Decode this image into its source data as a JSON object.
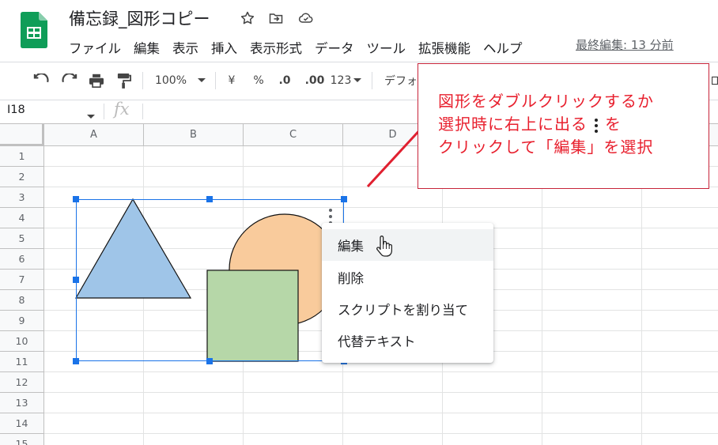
{
  "app": {
    "doc_title": "備忘録_図形コピー",
    "last_edit": "最終編集: 13 分前",
    "accent": "#1a73e8",
    "logo_color": "#0f9d58"
  },
  "menu": [
    "ファイル",
    "編集",
    "表示",
    "挿入",
    "表示形式",
    "データ",
    "ツール",
    "拡張機能",
    "ヘルプ"
  ],
  "toolbar": {
    "zoom": "100%",
    "currency": "¥",
    "percent": "%",
    "decimal_decrease": ".0",
    "decimal_increase": ".00",
    "number_format": "123",
    "font": "デフォ"
  },
  "formula_bar": {
    "cell_ref": "I18",
    "fx_label": "fx"
  },
  "sheet": {
    "columns": [
      "A",
      "B",
      "C",
      "D"
    ],
    "rows": [
      "1",
      "2",
      "3",
      "4",
      "5",
      "6",
      "7",
      "8",
      "9",
      "10",
      "11",
      "12",
      "13",
      "14",
      "15"
    ]
  },
  "shapes": {
    "triangle_color": "#9fc5e8",
    "circle_color": "#f9cb9c",
    "square_color": "#b6d7a8"
  },
  "context_menu": {
    "items": [
      {
        "label": "編集"
      },
      {
        "label": "削除"
      },
      {
        "label": "スクリプトを割り当て"
      },
      {
        "label": "代替テキスト"
      }
    ]
  },
  "callout": {
    "line1": "図形をダブルクリックするか",
    "line2_before": "選択時に右上に出る",
    "line2_after": "を",
    "line3": "クリックして「編集」を選択",
    "color": "#e8202e"
  }
}
